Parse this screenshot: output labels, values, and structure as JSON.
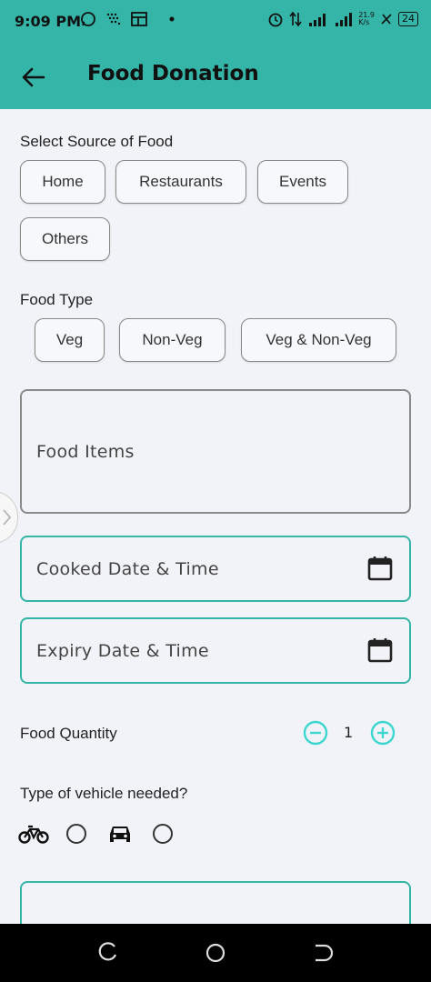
{
  "status": {
    "time": "9:09 PM",
    "battery": "24",
    "net_speed_top": "21.9",
    "net_speed_unit": "K/s"
  },
  "appbar": {
    "title": "Food Donation"
  },
  "source": {
    "label": "Select Source of Food",
    "options": [
      "Home",
      "Restaurants",
      "Events",
      "Others"
    ]
  },
  "food_type": {
    "label": "Food Type",
    "options": [
      "Veg",
      "Non-Veg",
      "Veg & Non-Veg"
    ]
  },
  "fields": {
    "food_items": "Food Items",
    "cooked": "Cooked Date & Time",
    "expiry": "Expiry Date & Time"
  },
  "quantity": {
    "label": "Food Quantity",
    "value": "1"
  },
  "vehicle": {
    "label": "Type of vehicle needed?"
  },
  "colors": {
    "accent": "#35b4a8",
    "quantity_icon": "#3dd6d0"
  }
}
